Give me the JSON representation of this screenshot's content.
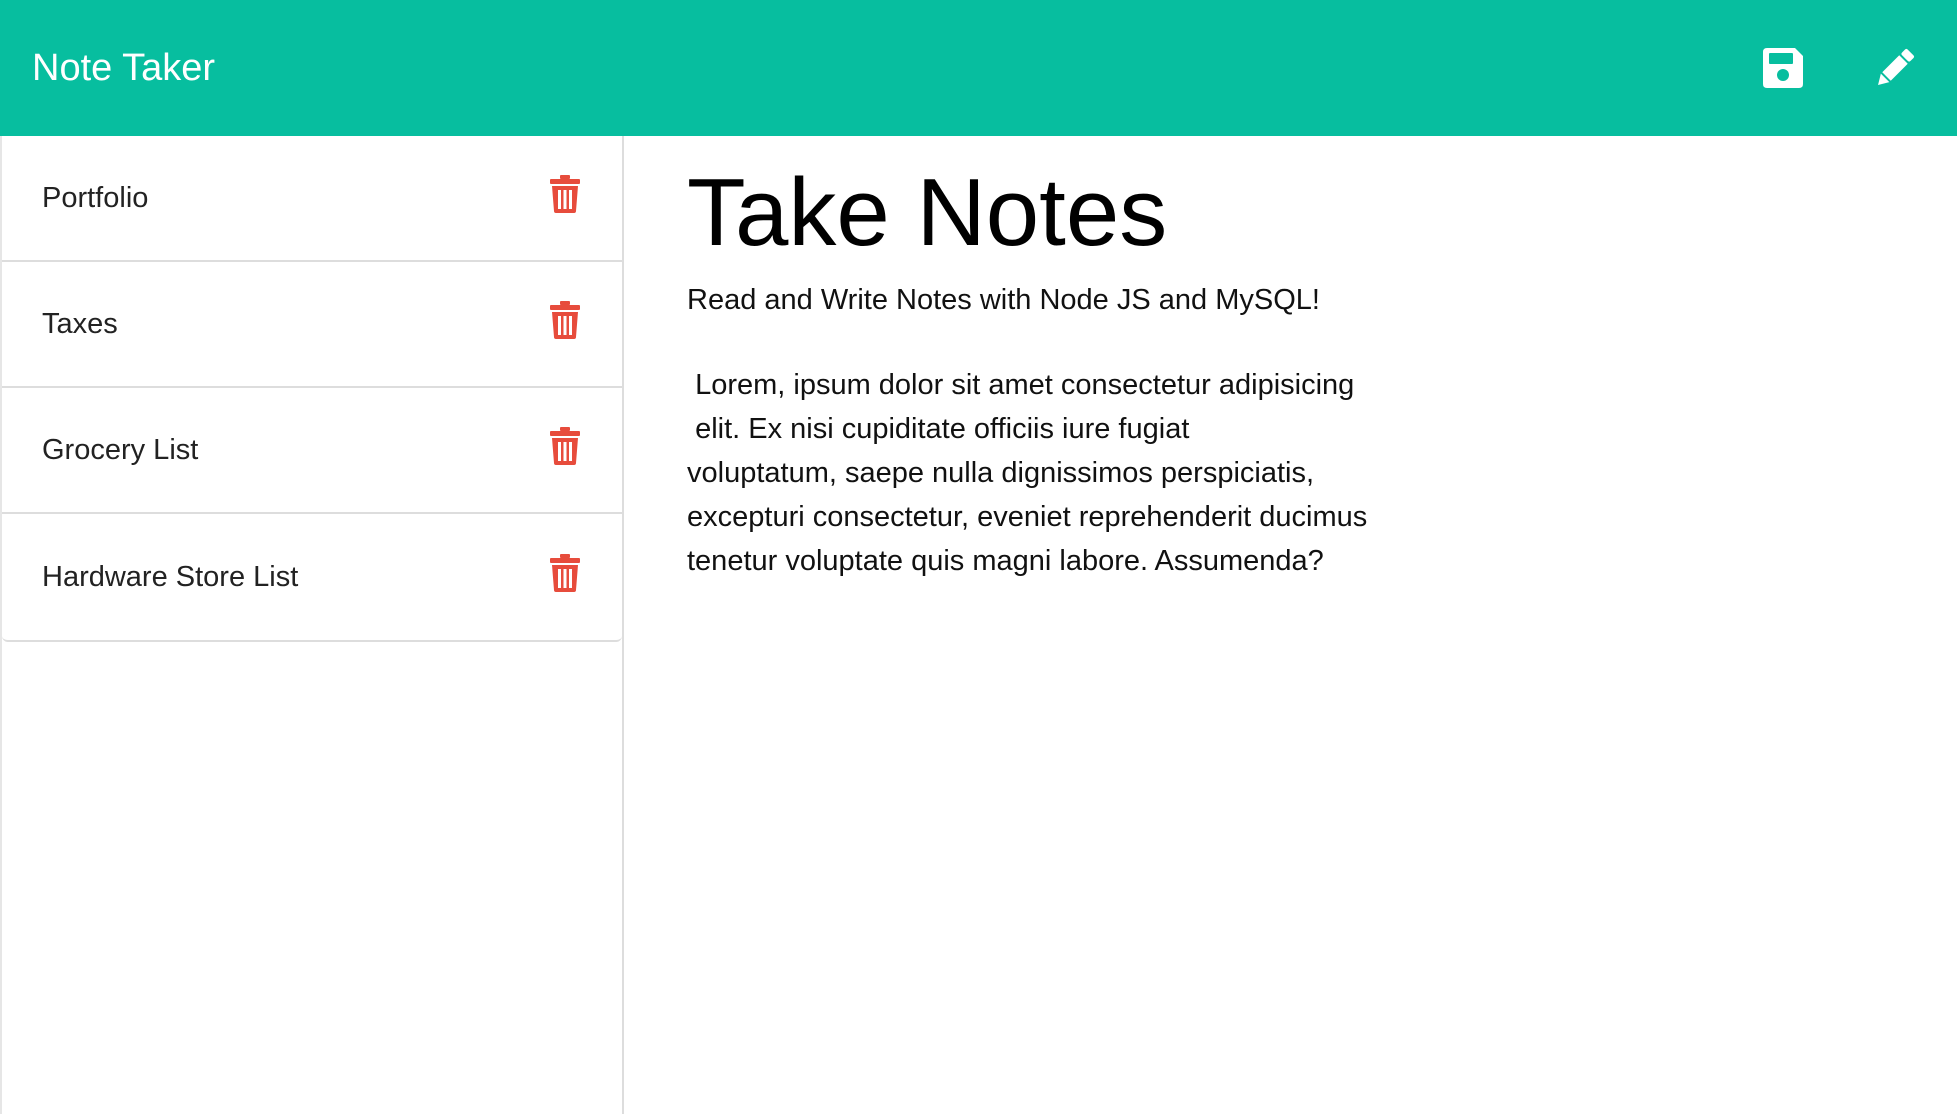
{
  "app": {
    "title": "Note Taker",
    "accent_color": "#07be9f",
    "delete_color": "#e74c3c"
  },
  "toolbar": {
    "save_icon": "floppy-disk-icon",
    "new_note_icon": "pencil-icon"
  },
  "sidebar": {
    "notes": [
      {
        "title": "Portfolio",
        "icon": "trash-icon"
      },
      {
        "title": "Taxes",
        "icon": "trash-icon"
      },
      {
        "title": "Grocery List",
        "icon": "trash-icon"
      },
      {
        "title": "Hardware Store List",
        "icon": "trash-icon"
      }
    ]
  },
  "main": {
    "title": "Take Notes",
    "subtitle": "Read and Write Notes with Node JS and MySQL!",
    "note_text": " Lorem, ipsum dolor sit amet consectetur adipisicing\n elit. Ex nisi cupiditate officiis iure fugiat\nvoluptatum, saepe nulla dignissimos perspiciatis,\nexcepturi consectetur, eveniet reprehenderit ducimus\ntenetur voluptate quis magni labore. Assumenda?"
  }
}
